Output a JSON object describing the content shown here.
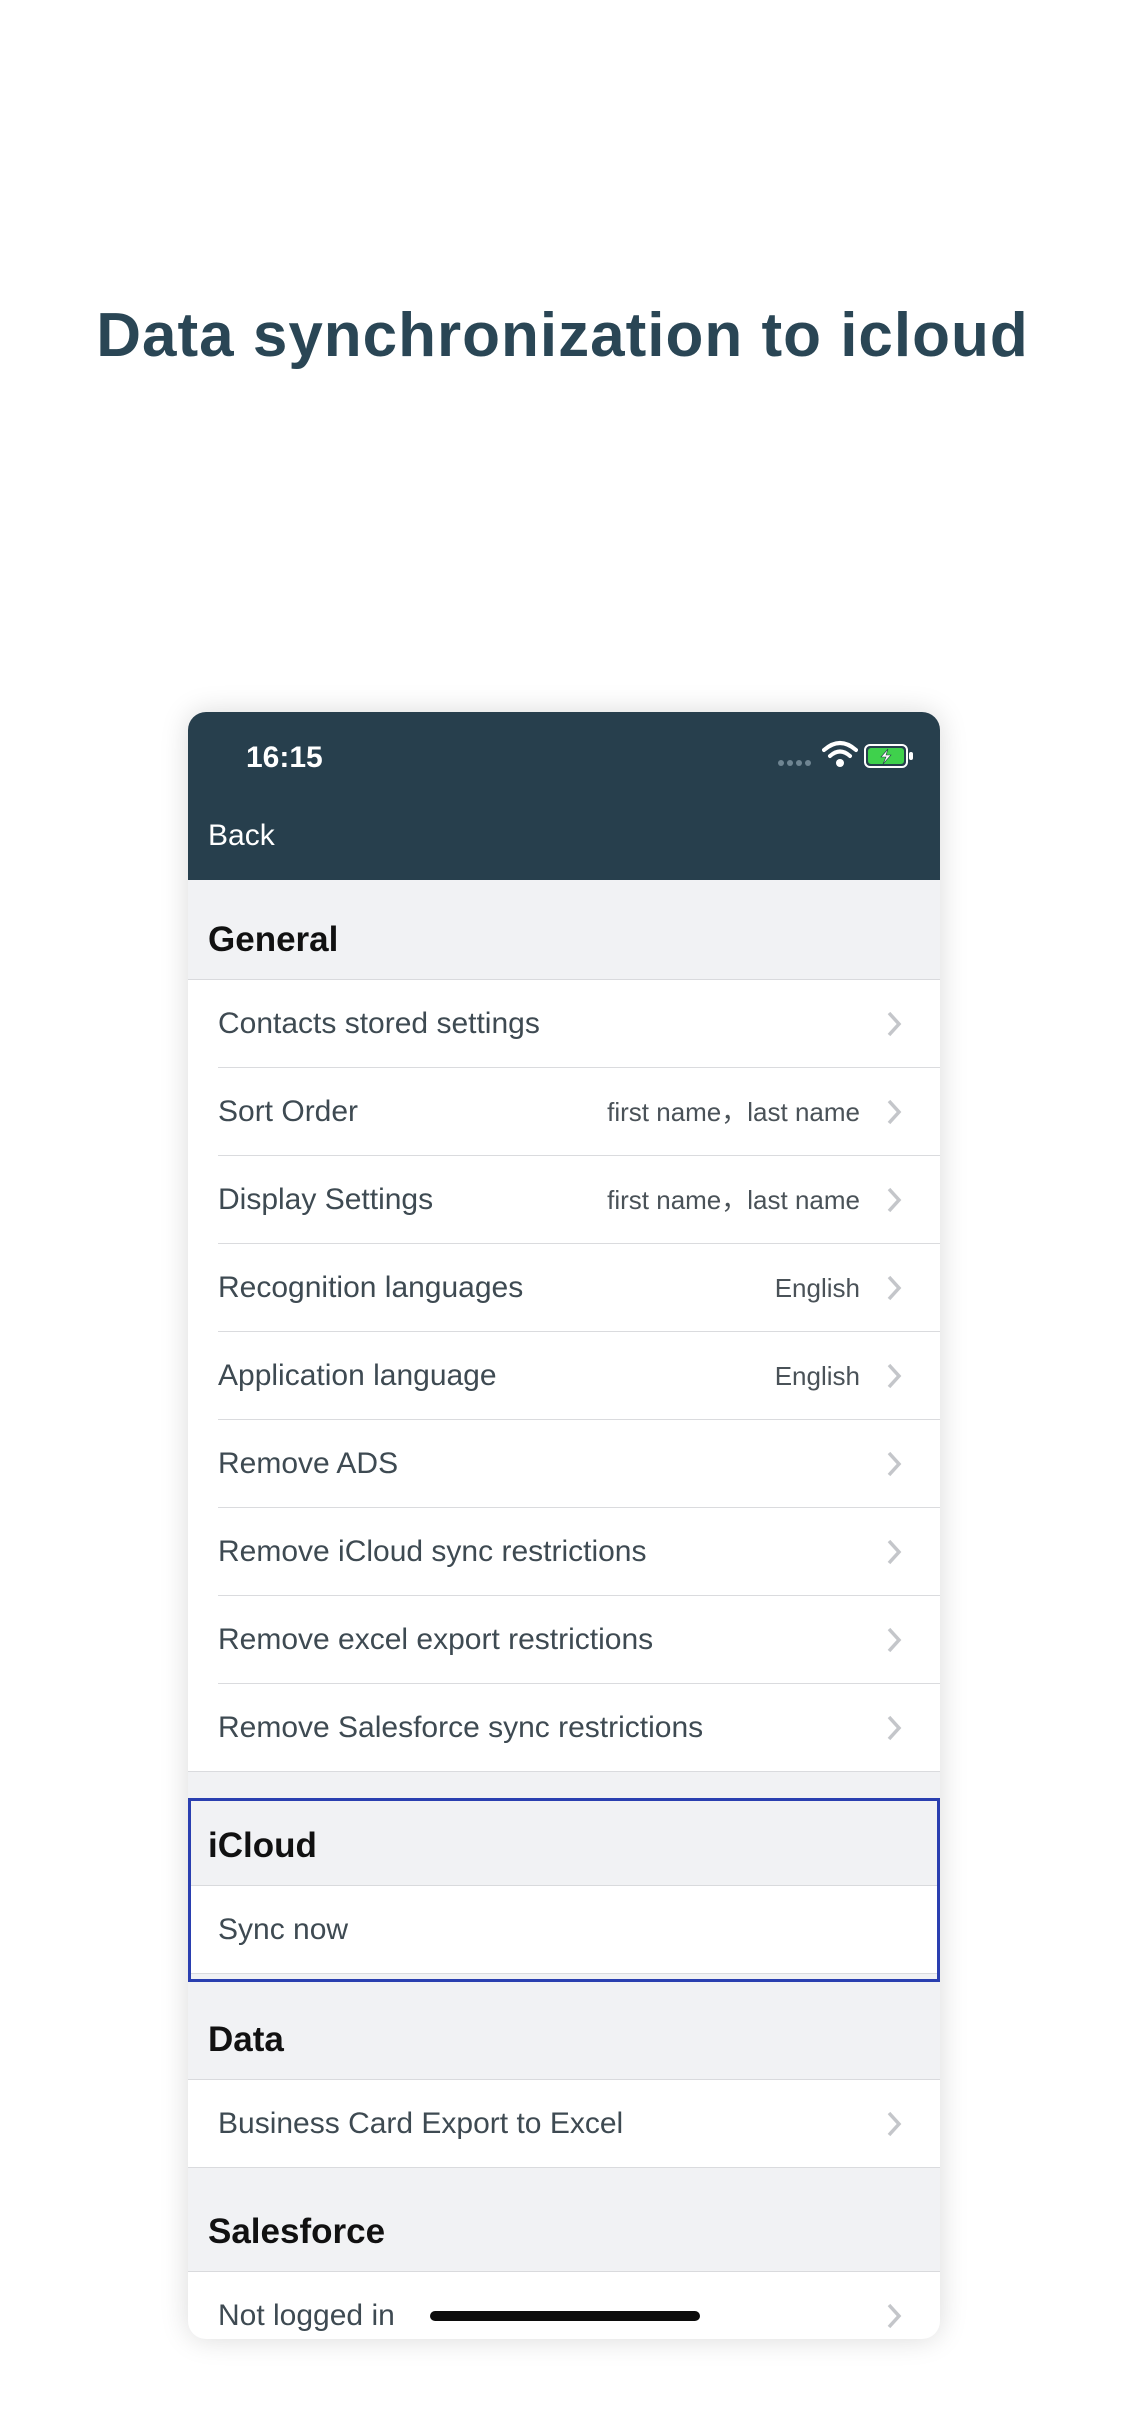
{
  "headline": "Data synchronization to icloud",
  "status_bar": {
    "time": "16:15",
    "icons": [
      "cellular-signal-icon",
      "wifi-icon",
      "battery-charging-icon"
    ]
  },
  "nav": {
    "back_label": "Back"
  },
  "sections": {
    "general": {
      "title": "General",
      "rows": [
        {
          "label": "Contacts stored settings",
          "value": ""
        },
        {
          "label": "Sort Order",
          "value": "first name，last name"
        },
        {
          "label": "Display Settings",
          "value": "first name，last name"
        },
        {
          "label": "Recognition languages",
          "value": "English"
        },
        {
          "label": "Application language",
          "value": "English"
        },
        {
          "label": "Remove ADS",
          "value": ""
        },
        {
          "label": "Remove iCloud sync restrictions",
          "value": ""
        },
        {
          "label": "Remove excel export restrictions",
          "value": ""
        },
        {
          "label": "Remove Salesforce sync restrictions",
          "value": ""
        }
      ]
    },
    "icloud": {
      "title": "iCloud",
      "rows": [
        {
          "label": "Sync now"
        }
      ]
    },
    "data": {
      "title": "Data",
      "rows": [
        {
          "label": "Business Card Export to Excel"
        }
      ]
    },
    "salesforce": {
      "title": "Salesforce",
      "rows": [
        {
          "label": "Not logged in"
        }
      ]
    }
  },
  "colors": {
    "header_bar": "#273f4d",
    "headline_text": "#2a4655",
    "list_background": "#f1f2f4",
    "highlight_border": "#2a3fb0",
    "battery_fill": "#3fd14c"
  }
}
